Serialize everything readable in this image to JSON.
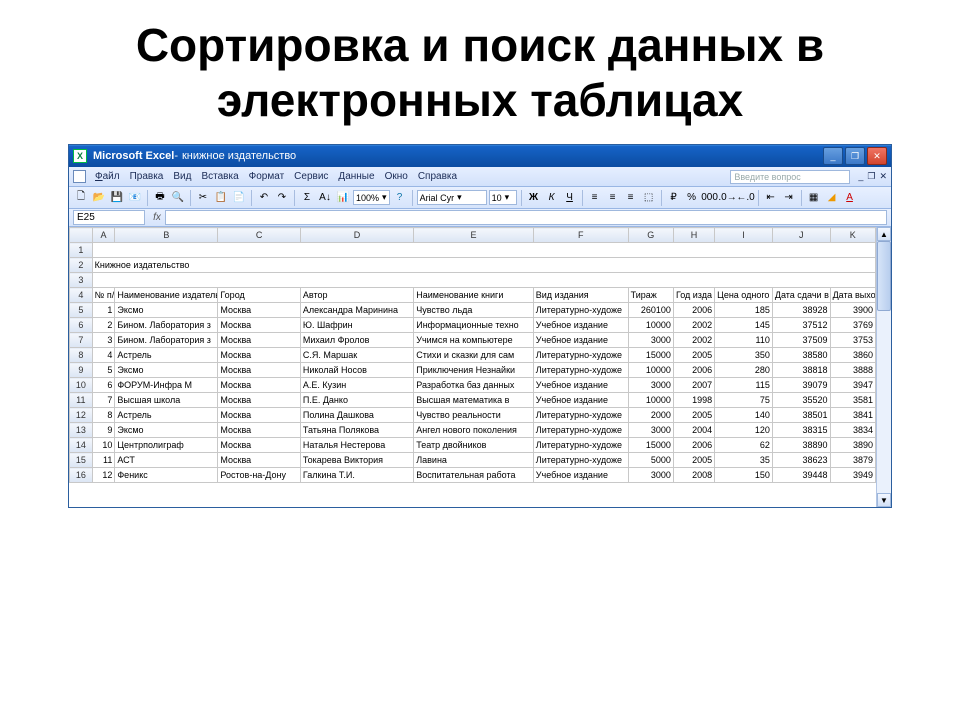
{
  "slide_title": "Сортировка и поиск данных в электронных таблицах",
  "titlebar": {
    "app": "Microsoft Excel",
    "doc": "книжное издательство"
  },
  "menu": {
    "file": "Файл",
    "edit": "Правка",
    "view": "Вид",
    "insert": "Вставка",
    "format": "Формат",
    "tools": "Сервис",
    "data": "Данные",
    "window": "Окно",
    "help": "Справка",
    "ask": "Введите вопрос"
  },
  "toolbar": {
    "zoom": "100%",
    "font": "Arial Cyr",
    "size": "10",
    "bold": "Ж",
    "italic": "К",
    "underline": "Ч"
  },
  "namebox": "E25",
  "cols": {
    "A": "A",
    "B": "B",
    "C": "C",
    "D": "D",
    "E": "E",
    "F": "F",
    "G": "G",
    "H": "H",
    "I": "I",
    "J": "J",
    "K": "K"
  },
  "sec_title": "Книжное издательство",
  "headers": {
    "no": "№ п/п",
    "pub": "Наименование издательства",
    "city": "Город",
    "author": "Автор",
    "book": "Наименование книги",
    "kind": "Вид издания",
    "tirazh": "Тираж",
    "year": "Год изда",
    "price": "Цена одного",
    "d1": "Дата сдачи в",
    "d2": "Дата выхода"
  },
  "rows": [
    {
      "n": "1",
      "pub": "Эксмо",
      "city": "Москва",
      "auth": "Александра Маринина",
      "book": "Чувство льда",
      "kind": "Литературно-художе",
      "t": "260100",
      "y": "2006",
      "p": "185",
      "d1": "38928",
      "d2": "3900"
    },
    {
      "n": "2",
      "pub": "Бином. Лаборатория з",
      "city": "Москва",
      "auth": "Ю. Шафрин",
      "book": "Информационные техно",
      "kind": "Учебное издание",
      "t": "10000",
      "y": "2002",
      "p": "145",
      "d1": "37512",
      "d2": "3769"
    },
    {
      "n": "3",
      "pub": "Бином. Лаборатория з",
      "city": "Москва",
      "auth": "Михаил Фролов",
      "book": "Учимся на компьютере",
      "kind": "Учебное издание",
      "t": "3000",
      "y": "2002",
      "p": "110",
      "d1": "37509",
      "d2": "3753"
    },
    {
      "n": "4",
      "pub": "Астрель",
      "city": "Москва",
      "auth": "С.Я. Маршак",
      "book": "Стихи и сказки для сам",
      "kind": "Литературно-художе",
      "t": "15000",
      "y": "2005",
      "p": "350",
      "d1": "38580",
      "d2": "3860"
    },
    {
      "n": "5",
      "pub": "Эксмо",
      "city": "Москва",
      "auth": "Николай Носов",
      "book": "Приключения Незнайки",
      "kind": "Литературно-художе",
      "t": "10000",
      "y": "2006",
      "p": "280",
      "d1": "38818",
      "d2": "3888"
    },
    {
      "n": "6",
      "pub": "ФОРУМ-Инфра М",
      "city": "Москва",
      "auth": "А.Е. Кузин",
      "book": "Разработка баз данных",
      "kind": "Учебное издание",
      "t": "3000",
      "y": "2007",
      "p": "115",
      "d1": "39079",
      "d2": "3947"
    },
    {
      "n": "7",
      "pub": "Высшая школа",
      "city": "Москва",
      "auth": "П.Е. Данко",
      "book": "Высшая математика в",
      "kind": "Учебное издание",
      "t": "10000",
      "y": "1998",
      "p": "75",
      "d1": "35520",
      "d2": "3581"
    },
    {
      "n": "8",
      "pub": "Астрель",
      "city": "Москва",
      "auth": "Полина Дашкова",
      "book": "Чувство реальности",
      "kind": "Литературно-художе",
      "t": "2000",
      "y": "2005",
      "p": "140",
      "d1": "38501",
      "d2": "3841"
    },
    {
      "n": "9",
      "pub": "Эксмо",
      "city": "Москва",
      "auth": "Татьяна Полякова",
      "book": "Ангел нового поколения",
      "kind": "Литературно-художе",
      "t": "3000",
      "y": "2004",
      "p": "120",
      "d1": "38315",
      "d2": "3834"
    },
    {
      "n": "10",
      "pub": "Центрполиграф",
      "city": "Москва",
      "auth": "Наталья Нестерова",
      "book": "Театр двойников",
      "kind": "Литературно-художе",
      "t": "15000",
      "y": "2006",
      "p": "62",
      "d1": "38890",
      "d2": "3890"
    },
    {
      "n": "11",
      "pub": "АСТ",
      "city": "Москва",
      "auth": "Токарева Виктория",
      "book": "Лавина",
      "kind": "Литературно-художе",
      "t": "5000",
      "y": "2005",
      "p": "35",
      "d1": "38623",
      "d2": "3879"
    },
    {
      "n": "12",
      "pub": "Феникс",
      "city": "Ростов-на-Дону",
      "auth": "Галкина Т.И.",
      "book": "Воспитательная работа",
      "kind": "Учебное издание",
      "t": "3000",
      "y": "2008",
      "p": "150",
      "d1": "39448",
      "d2": "3949"
    }
  ]
}
